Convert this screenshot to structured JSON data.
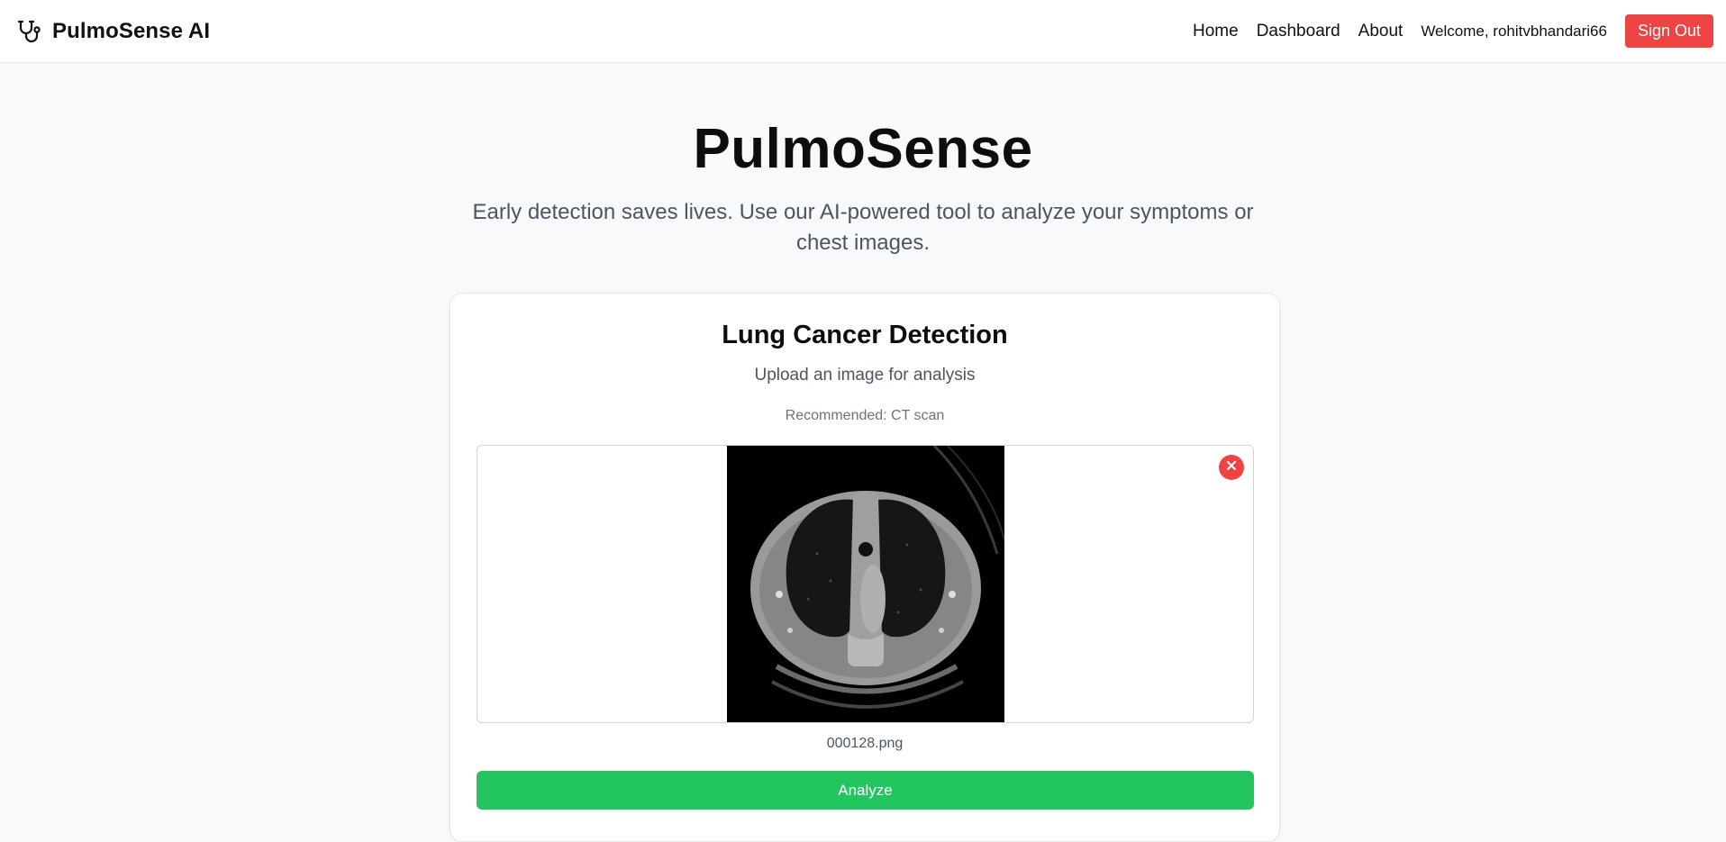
{
  "navbar": {
    "brand_icon": "stethoscope-icon",
    "brand_name": "PulmoSense AI",
    "links": [
      "Home",
      "Dashboard",
      "About"
    ],
    "welcome": "Welcome, rohitvbhandari66",
    "signout_label": "Sign Out"
  },
  "hero": {
    "title": "PulmoSense",
    "subtitle": "Early detection saves lives. Use our AI-powered tool to analyze your symptoms or chest images."
  },
  "card": {
    "title": "Lung Cancer Detection",
    "subtitle": "Upload an image for analysis",
    "recommendation": "Recommended: CT scan",
    "preview_image": "ct-scan-image",
    "remove_icon": "close-icon",
    "filename": "000128.png",
    "analyze_label": "Analyze"
  },
  "colors": {
    "accent_red": "#ef4444",
    "accent_green": "#22c55e",
    "page_bg": "#f8f9fb"
  }
}
